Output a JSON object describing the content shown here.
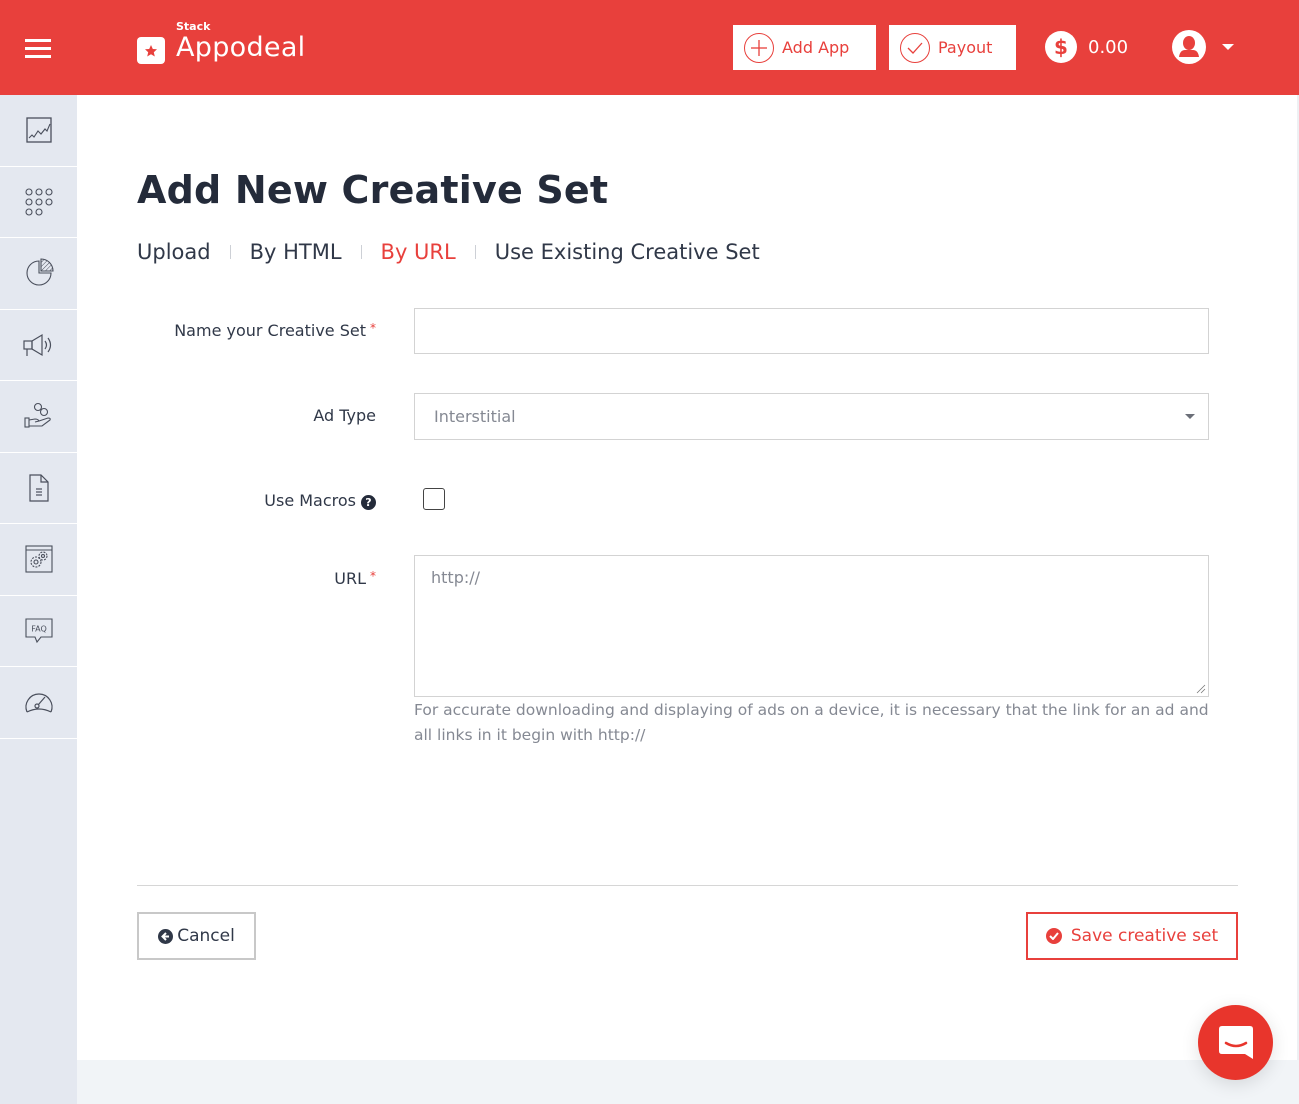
{
  "header": {
    "brand_small": "Stack",
    "brand_name": "Appodeal",
    "add_app_label": "Add App",
    "payout_label": "Payout",
    "balance": "0.00",
    "brand_color": "#e8403c"
  },
  "sidebar": {
    "items": [
      {
        "icon": "line-chart-icon"
      },
      {
        "icon": "apps-grid-icon"
      },
      {
        "icon": "pie-chart-icon"
      },
      {
        "icon": "megaphone-icon"
      },
      {
        "icon": "hand-coins-icon"
      },
      {
        "icon": "document-icon"
      },
      {
        "icon": "settings-window-icon"
      },
      {
        "icon": "faq-icon"
      },
      {
        "icon": "speedometer-icon"
      }
    ]
  },
  "page": {
    "title": "Add New Creative Set",
    "tabs": [
      {
        "label": "Upload",
        "active": false
      },
      {
        "label": "By HTML",
        "active": false
      },
      {
        "label": "By URL",
        "active": true
      },
      {
        "label": "Use Existing Creative Set",
        "active": false
      }
    ]
  },
  "form": {
    "name_label": "Name your Creative Set",
    "name_value": "",
    "required_mark": "*",
    "ad_type_label": "Ad Type",
    "ad_type_value": "Interstitial",
    "macros_label": "Use Macros",
    "macros_help": "?",
    "macros_checked": false,
    "url_label": "URL",
    "url_placeholder": "http://",
    "url_hint": "For accurate downloading and displaying of ads on a device, it is necessary that the link for an ad and all links in it begin with http://"
  },
  "actions": {
    "cancel_label": "Cancel",
    "save_label": "Save creative set"
  }
}
